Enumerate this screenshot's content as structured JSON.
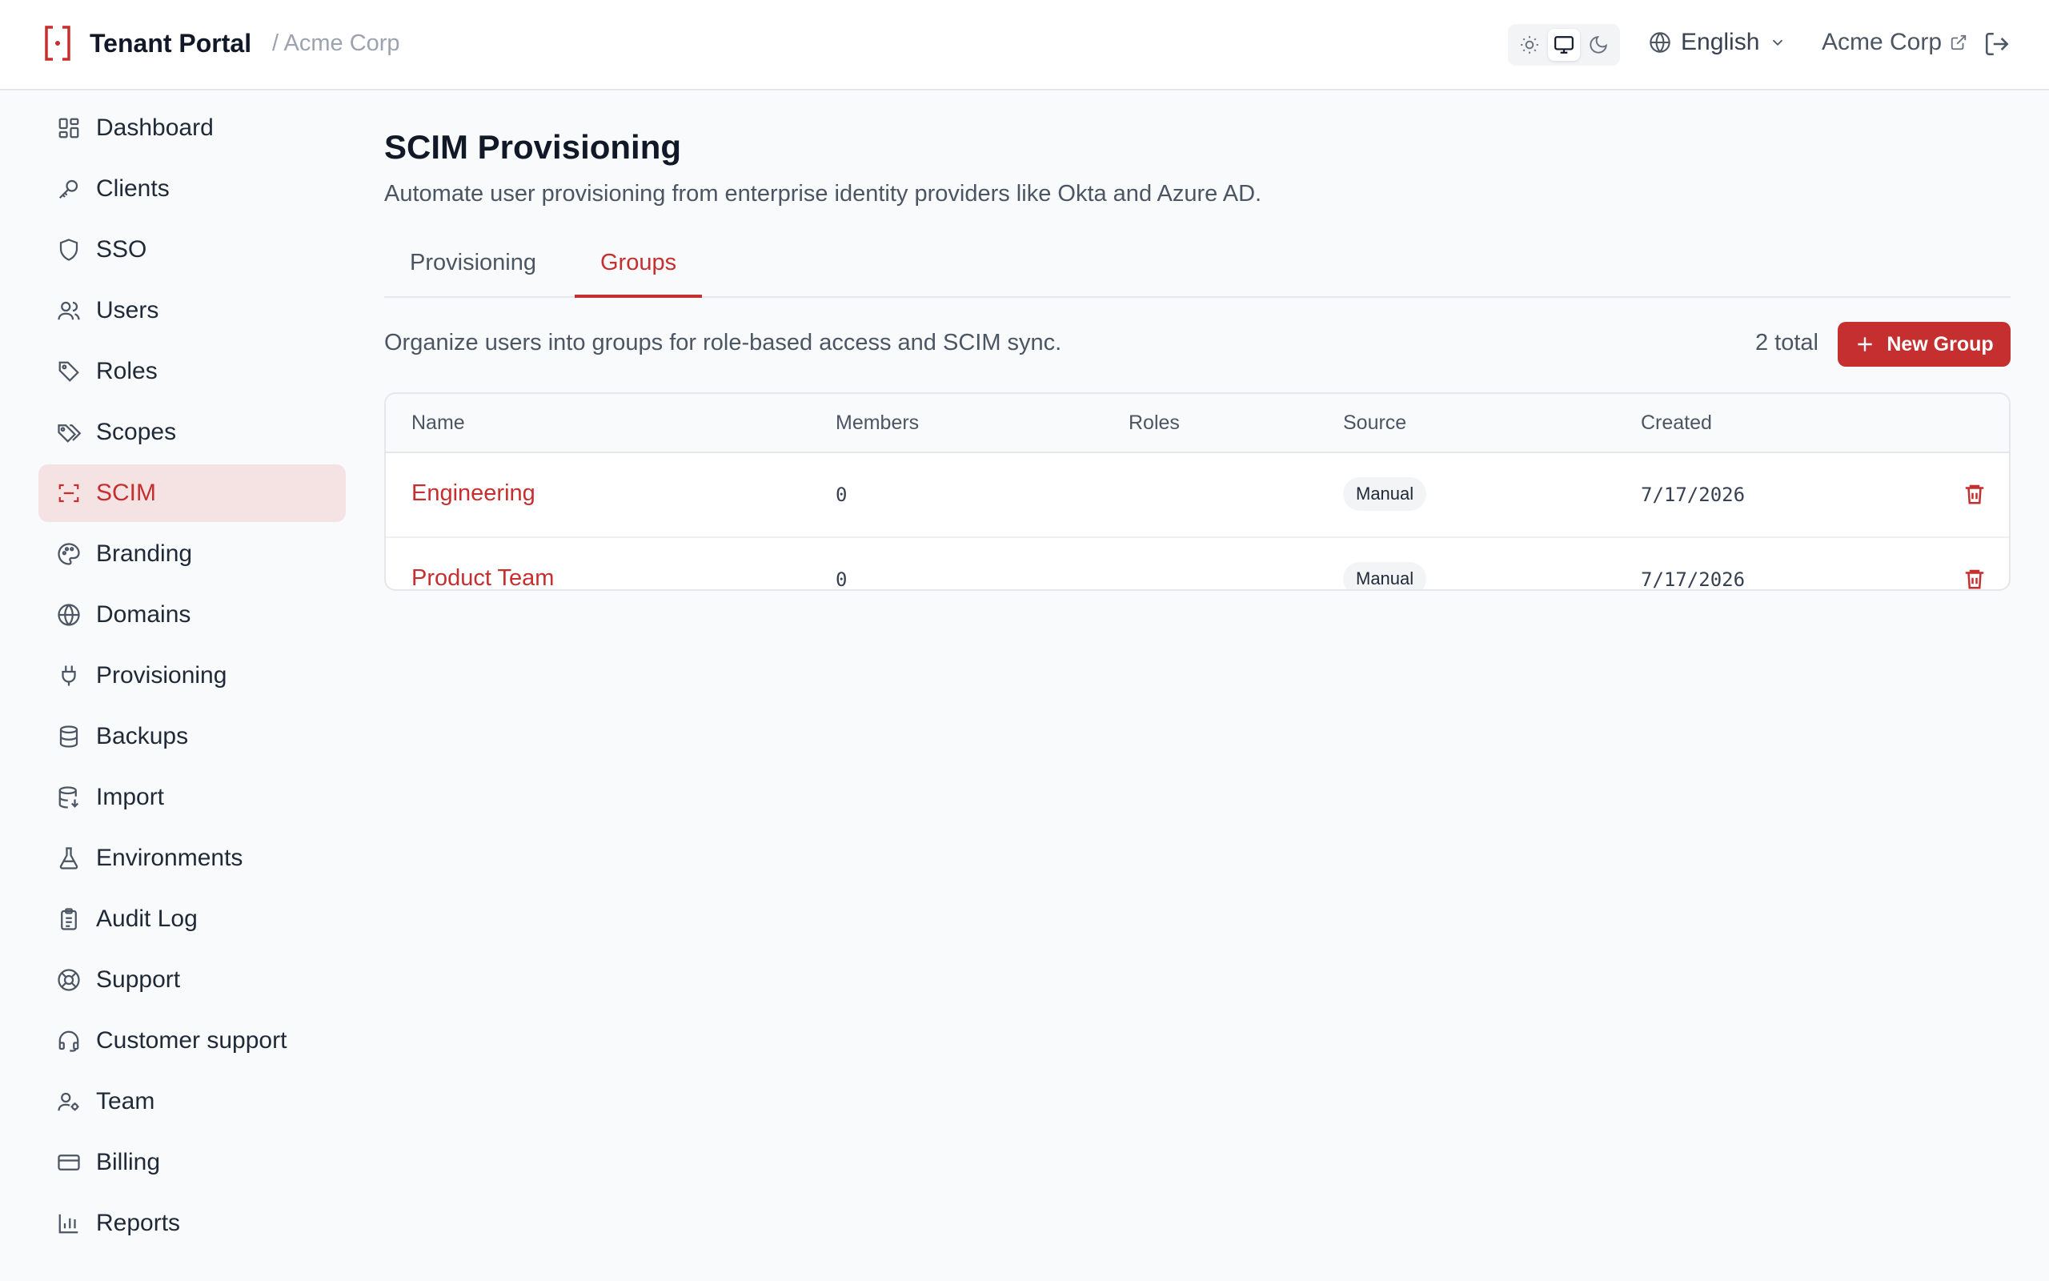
{
  "header": {
    "app_title": "Tenant Portal",
    "breadcrumb": "/ Acme Corp",
    "language": "English",
    "tenant_name": "Acme Corp",
    "theme_active": "system"
  },
  "sidebar": {
    "items": [
      {
        "label": "Dashboard",
        "icon": "dashboard-icon"
      },
      {
        "label": "Clients",
        "icon": "key-icon"
      },
      {
        "label": "SSO",
        "icon": "shield-icon"
      },
      {
        "label": "Users",
        "icon": "users-icon"
      },
      {
        "label": "Roles",
        "icon": "tag-icon"
      },
      {
        "label": "Scopes",
        "icon": "tags-icon"
      },
      {
        "label": "SCIM",
        "icon": "scan-icon",
        "active": true
      },
      {
        "label": "Branding",
        "icon": "palette-icon"
      },
      {
        "label": "Domains",
        "icon": "globe-icon"
      },
      {
        "label": "Provisioning",
        "icon": "plug-icon"
      },
      {
        "label": "Backups",
        "icon": "database-icon"
      },
      {
        "label": "Import",
        "icon": "database-import-icon"
      },
      {
        "label": "Environments",
        "icon": "flask-icon"
      },
      {
        "label": "Audit Log",
        "icon": "clipboard-icon"
      },
      {
        "label": "Support",
        "icon": "lifebuoy-icon"
      },
      {
        "label": "Customer support",
        "icon": "headset-icon"
      },
      {
        "label": "Team",
        "icon": "user-cog-icon"
      },
      {
        "label": "Billing",
        "icon": "credit-card-icon"
      },
      {
        "label": "Reports",
        "icon": "bar-chart-icon"
      }
    ]
  },
  "main": {
    "title": "SCIM Provisioning",
    "description": "Automate user provisioning from enterprise identity providers like Okta and Azure AD.",
    "tabs": [
      {
        "label": "Provisioning",
        "active": false
      },
      {
        "label": "Groups",
        "active": true
      }
    ],
    "groups_description": "Organize users into groups for role-based access and SCIM sync.",
    "total": "2 total",
    "new_button": "New Group",
    "table": {
      "columns": [
        "Name",
        "Members",
        "Roles",
        "Source",
        "Created"
      ],
      "rows": [
        {
          "name": "Engineering",
          "members": "0",
          "roles": "",
          "source": "Manual",
          "created": "7/17/2026"
        },
        {
          "name": "Product Team",
          "members": "0",
          "roles": "",
          "source": "Manual",
          "created": "7/17/2026"
        }
      ]
    }
  },
  "colors": {
    "accent": "#c62f2f",
    "active_bg": "#f5e3e3"
  }
}
